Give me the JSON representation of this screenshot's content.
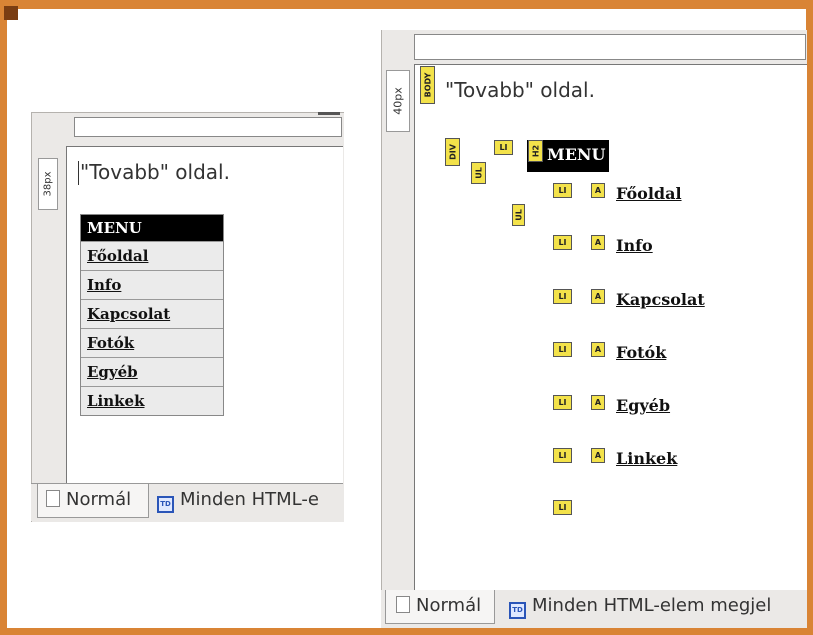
{
  "left_editor": {
    "side_ruler_label": "38px",
    "body_text": "\"Tovabb\" oldal.",
    "menu_heading": "MENU",
    "menu_items": [
      "Főoldal",
      "Info",
      "Kapcsolat",
      "Fotók",
      "Egyéb",
      "Linkek"
    ],
    "tabs": {
      "normal": "Normál",
      "all_elements": "Minden HTML-e"
    }
  },
  "right_editor": {
    "side_ruler_label": "40px",
    "body_text": "\"Tovabb\" oldal.",
    "menu_heading": "MENU",
    "menu_items": [
      "Főoldal",
      "Info",
      "Kapcsolat",
      "Fotók",
      "Egyéb",
      "Linkek"
    ],
    "tag_labels": {
      "body": "BODY",
      "div": "DIV",
      "ul": "UL",
      "li": "LI",
      "a": "A",
      "h2": "H2"
    },
    "tabs": {
      "normal": "Normál",
      "all_elements": "Minden HTML-elem megjel"
    }
  },
  "colors": {
    "frame": "#d98435",
    "tag_marker": "#f3e24a",
    "menu_heading_bg": "#000000"
  }
}
